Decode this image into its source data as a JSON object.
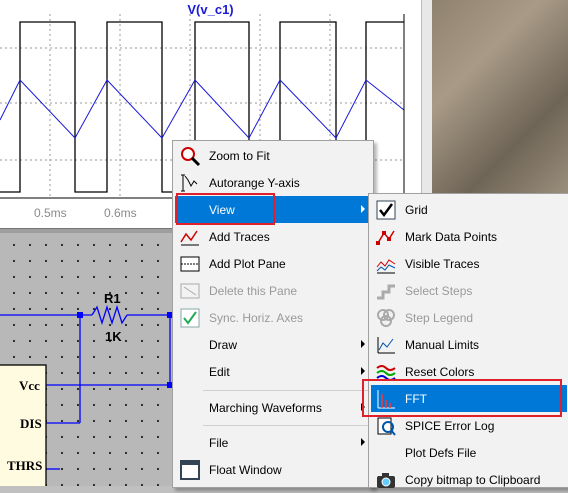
{
  "waveform": {
    "title": "V(v_c1)",
    "x_ticks": [
      "0.5ms",
      "0.6ms"
    ],
    "colors": {
      "title": "#1a1adc",
      "trace": "#1a1adc",
      "square": "#000000",
      "grid": "#999999"
    }
  },
  "schematic": {
    "resistor_name": "R1",
    "resistor_value": "1K",
    "pins": [
      "Vcc",
      "DIS",
      "THRS"
    ],
    "wire_color": "#0000ff"
  },
  "context_menu": {
    "items": [
      {
        "label": "Zoom to Fit",
        "icon": "zoom-fit-icon"
      },
      {
        "label": "Autorange Y-axis",
        "icon": "autorange-icon"
      },
      {
        "label": "View",
        "has_submenu": true,
        "highlighted": true
      },
      {
        "label": "Add Traces",
        "icon": "add-traces-icon"
      },
      {
        "label": "Add Plot Pane",
        "icon": "add-pane-icon"
      },
      {
        "label": "Delete this Pane",
        "icon": "delete-pane-icon",
        "disabled": true
      },
      {
        "label": "Sync. Horiz. Axes",
        "icon": "checkmark-icon",
        "disabled": true
      },
      {
        "label": "Draw",
        "has_submenu": true
      },
      {
        "label": "Edit",
        "has_submenu": true
      },
      {
        "label": "Marching Waveforms",
        "has_submenu": true
      },
      {
        "label": "File",
        "has_submenu": true
      },
      {
        "label": "Float Window",
        "icon": "float-window-icon"
      }
    ]
  },
  "view_submenu": {
    "items": [
      {
        "label": "Grid",
        "icon": "grid-check-icon"
      },
      {
        "label": "Mark Data Points",
        "icon": "mark-points-icon"
      },
      {
        "label": "Visible Traces",
        "icon": "visible-traces-icon"
      },
      {
        "label": "Select Steps",
        "icon": "select-steps-icon",
        "disabled": true
      },
      {
        "label": "Step Legend",
        "icon": "step-legend-icon",
        "disabled": true
      },
      {
        "label": "Manual Limits",
        "icon": "manual-limits-icon"
      },
      {
        "label": "Reset Colors",
        "icon": "reset-colors-icon"
      },
      {
        "label": "FFT",
        "icon": "fft-icon",
        "highlighted": true
      },
      {
        "label": "SPICE Error Log",
        "icon": "error-log-icon"
      },
      {
        "label": "Plot Defs File"
      },
      {
        "label": "Copy bitmap to Clipboard",
        "icon": "camera-icon"
      }
    ]
  }
}
